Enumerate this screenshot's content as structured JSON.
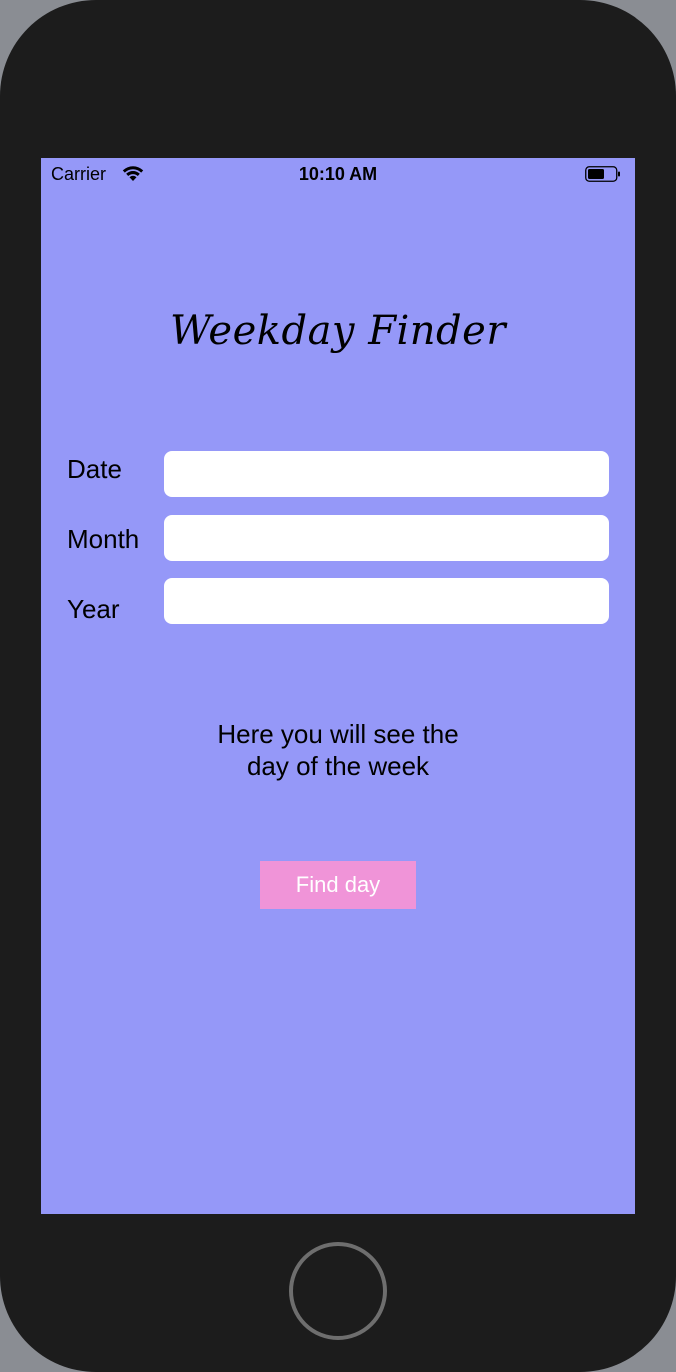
{
  "status_bar": {
    "carrier": "Carrier",
    "time": "10:10 AM",
    "wifi_icon": "wifi-icon",
    "battery_icon": "battery-icon"
  },
  "title": "Weekday Finder",
  "form": {
    "date_label": "Date",
    "date_value": "",
    "month_label": "Month",
    "month_value": "",
    "year_label": "Year",
    "year_value": ""
  },
  "result": {
    "line1": "Here you will see the",
    "line2": "day of the week"
  },
  "button": {
    "label": "Find day"
  },
  "colors": {
    "background": "#9598f8",
    "button": "#f094d8",
    "button_text": "#ffffff",
    "bezel": "#1c1c1c"
  }
}
